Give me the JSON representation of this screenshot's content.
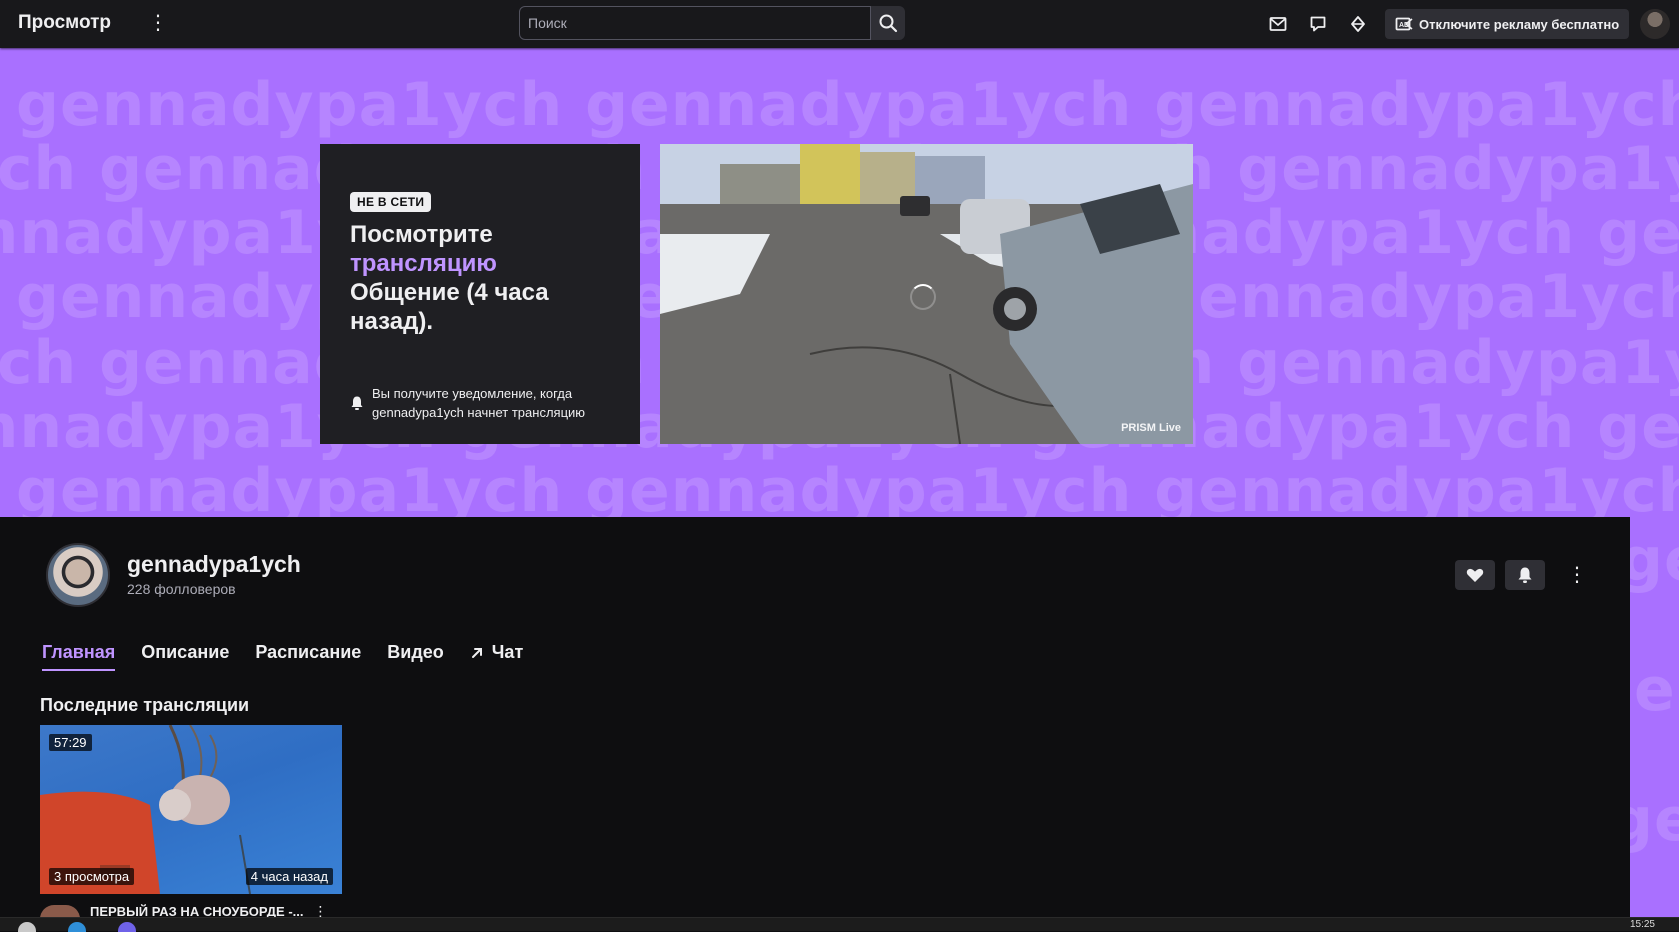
{
  "header": {
    "brand": "Просмотр",
    "more_label": "⋮",
    "search_placeholder": "Поиск",
    "adfree_label": "Отключите рекламу бесплатно",
    "icons": [
      "inbox-icon",
      "whispers-icon",
      "prime-loot-icon",
      "search-icon"
    ]
  },
  "banner": {
    "watermark_text": "gennadypa1ych",
    "offline_badge": "НЕ В СЕТИ",
    "title_line1": "Посмотрите",
    "title_link": "трансляцию",
    "title_line3": "Общение (4 часа назад).",
    "notify_line1": "Вы получите уведомление, когда",
    "notify_line2": "gennadypa1ych начнет трансляцию",
    "video_watermark": "PRISM Live"
  },
  "channel": {
    "name": "gennadypa1ych",
    "followers": "228 фолловеров",
    "more_label": "⋮",
    "tabs": [
      {
        "label": "Главная",
        "active": true
      },
      {
        "label": "Описание",
        "active": false
      },
      {
        "label": "Расписание",
        "active": false
      },
      {
        "label": "Видео",
        "active": false
      },
      {
        "label": "Чат",
        "active": false
      }
    ]
  },
  "recent": {
    "section_title": "Последние трансляции",
    "video": {
      "duration": "57:29",
      "views": "3 просмотра",
      "age": "4 часа назад",
      "title": "ПЕРВЫЙ РАЗ НА СНОУБОРДЕ -...",
      "more_label": "⋮"
    }
  },
  "taskbar": {
    "clock": "15:25"
  },
  "colors": {
    "accent": "#a970ff",
    "accent_text": "#bf94ff",
    "background": "#0e0e10",
    "topbar": "#18181b"
  }
}
